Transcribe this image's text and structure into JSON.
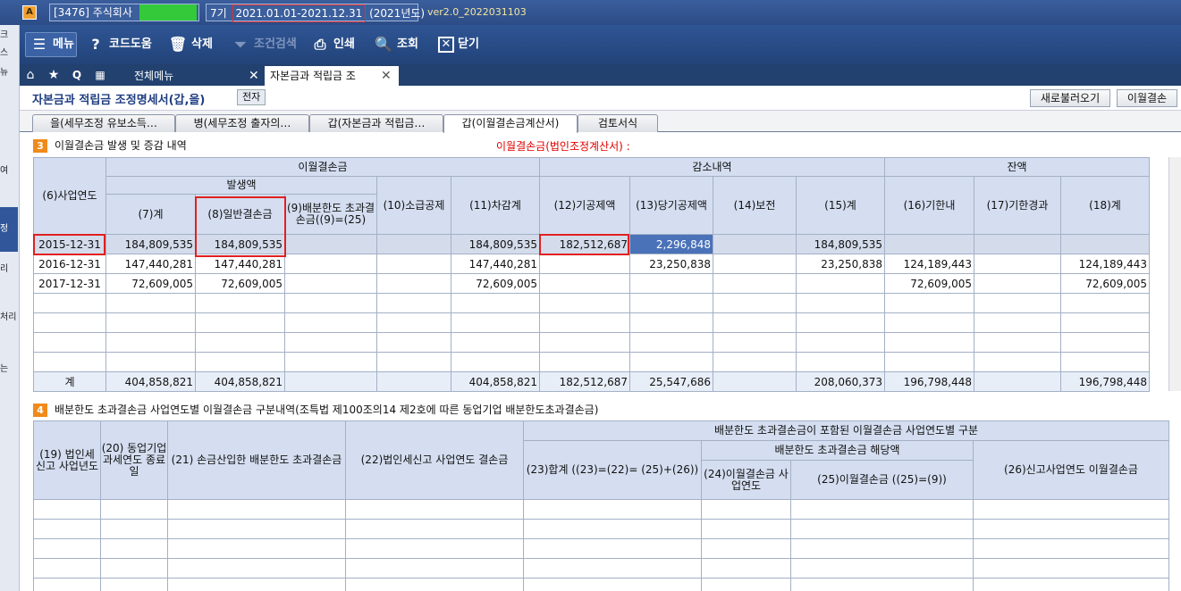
{
  "titlebar": {
    "app_icon": "app-logo-icon",
    "company": "[3476] 주식회사",
    "period_no": "7기",
    "period_range": "2021.01.01-2021.12.31",
    "fiscal_year": "(2021년도)",
    "version": "ver2.0_2022031103"
  },
  "toolbar": {
    "menu": "메뉴",
    "code_help": "코드도움",
    "delete": "삭제",
    "filter": "조건검색",
    "print": "인쇄",
    "search": "조회",
    "close": "닫기"
  },
  "tabs": {
    "all_menu": "전체메뉴",
    "active": "자본금과 적립금 조"
  },
  "left_strip": [
    "크",
    "스",
    "뉴",
    "여",
    "정",
    "리",
    "처리",
    "는"
  ],
  "page": {
    "title": "자본금과 적립금 조정명세서(갑,을)",
    "badge": "전자",
    "btn_reload": "새로불러오기",
    "btn_carryover": "이월결손"
  },
  "subtabs": [
    "을(세무조정 유보소득…",
    "병(세무조정 출자의…",
    "갑(자본금과 적립금…",
    "갑(이월결손금계산서)",
    "검토서식"
  ],
  "section3": {
    "num": "3",
    "title": "이월결손금 발생 및 증감 내역",
    "red_note": "이월결손금(법인조정계산서) :",
    "headers": {
      "year": "(6)사업연도",
      "carry": "이월결손금",
      "occur": "발생액",
      "decrease": "감소내역",
      "balance": "잔액",
      "c7": "(7)계",
      "c8": "(8)일반결손금",
      "c9": "(9)배분한도 초과결손금((9)=(25)",
      "c10": "(10)소급공제",
      "c11": "(11)차감계",
      "c12": "(12)기공제액",
      "c13": "(13)당기공제액",
      "c14": "(14)보전",
      "c15": "(15)계",
      "c16": "(16)기한내",
      "c17": "(17)기한경과",
      "c18": "(18)계"
    },
    "rows": [
      [
        "2015-12-31",
        "184,809,535",
        "184,809,535",
        "",
        "",
        "184,809,535",
        "182,512,687",
        "2,296,848",
        "",
        "184,809,535",
        "",
        "",
        ""
      ],
      [
        "2016-12-31",
        "147,440,281",
        "147,440,281",
        "",
        "",
        "147,440,281",
        "",
        "23,250,838",
        "",
        "23,250,838",
        "124,189,443",
        "",
        "124,189,443"
      ],
      [
        "2017-12-31",
        "72,609,005",
        "72,609,005",
        "",
        "",
        "72,609,005",
        "",
        "",
        "",
        "",
        "72,609,005",
        "",
        "72,609,005"
      ],
      [
        "",
        "",
        "",
        "",
        "",
        "",
        "",
        "",
        "",
        "",
        "",
        "",
        ""
      ],
      [
        "",
        "",
        "",
        "",
        "",
        "",
        "",
        "",
        "",
        "",
        "",
        "",
        ""
      ],
      [
        "",
        "",
        "",
        "",
        "",
        "",
        "",
        "",
        "",
        "",
        "",
        "",
        ""
      ],
      [
        "",
        "",
        "",
        "",
        "",
        "",
        "",
        "",
        "",
        "",
        "",
        "",
        ""
      ]
    ],
    "total": [
      "계",
      "404,858,821",
      "404,858,821",
      "",
      "",
      "404,858,821",
      "182,512,687",
      "25,547,686",
      "",
      "208,060,373",
      "196,798,448",
      "",
      "196,798,448"
    ]
  },
  "section4": {
    "num": "4",
    "title": "배분한도 초과결손금 사업연도별 이월결손금 구분내역(조특법 제100조의14 제2호에 따른 동업기업 배분한도초과결손금)",
    "headers": {
      "c19": "(19) 법인세 신고 사업년도",
      "c20": "(20) 동업기업 과세연도 종료일",
      "c21": "(21) 손금산입한 배분한도 초과결손금",
      "c22": "(22)법인세신고 사업연도 결손금",
      "group": "배분한도 초과결손금이 포함된 이월결손금 사업연도별 구분",
      "sub": "배분한도 초과결손금 해당액",
      "c23": "(23)합계 ((23)=(22)= (25)+(26))",
      "c24": "(24)이월결손금 사업연도",
      "c25": "(25)이월결손금 ((25)=(9))",
      "c26": "(26)신고사업연도 이월결손금"
    }
  }
}
